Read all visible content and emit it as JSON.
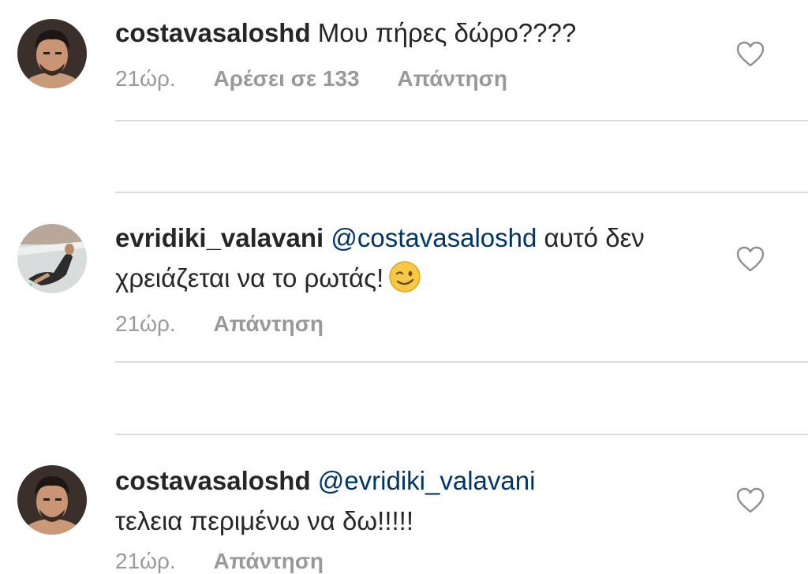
{
  "comments": [
    {
      "username": "costavasaloshd",
      "mention": "",
      "text": "Μου πήρες δώρο????",
      "time": "21ώρ.",
      "likes": "Αρέσει σε 133",
      "reply": "Απάντηση",
      "avatar_icon": "profile-photo-man"
    },
    {
      "username": "evridiki_valavani",
      "mention": "@costavasaloshd",
      "text": "αυτό δεν χρειάζεται να το ρωτάς!",
      "emoji_icon": "winking-face-emoji",
      "time": "21ώρ.",
      "reply": "Απάντηση",
      "avatar_icon": "profile-photo-woman"
    },
    {
      "username": "costavasaloshd",
      "mention": "@evridiki_valavani",
      "text": "τελεια περιμένω να δω!!!!!",
      "time": "21ώρ.",
      "reply": "Απάντηση",
      "avatar_icon": "profile-photo-man"
    }
  ],
  "colors": {
    "text": "#262626",
    "meta": "#999999",
    "mention": "#003569",
    "divider": "#dbdbdb"
  }
}
